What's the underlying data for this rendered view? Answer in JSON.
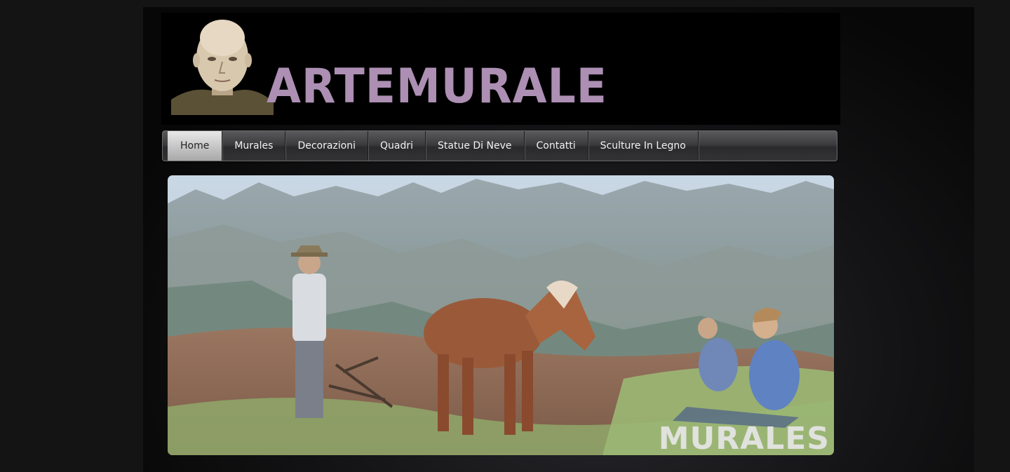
{
  "header": {
    "logo_text": "ARTEMURALE"
  },
  "nav": {
    "items": [
      {
        "label": "Home",
        "active": true
      },
      {
        "label": "Murales"
      },
      {
        "label": "Decorazioni"
      },
      {
        "label": "Quadri"
      },
      {
        "label": "Statue Di Neve"
      },
      {
        "label": "Contatti"
      },
      {
        "label": "Sculture In Legno"
      }
    ]
  },
  "banner": {
    "caption": "MURALES"
  },
  "colors": {
    "logo": "#ad8fb3",
    "background": "#141414",
    "nav_bar": "#3c3c3e",
    "nav_active": "#d0d0d0"
  }
}
